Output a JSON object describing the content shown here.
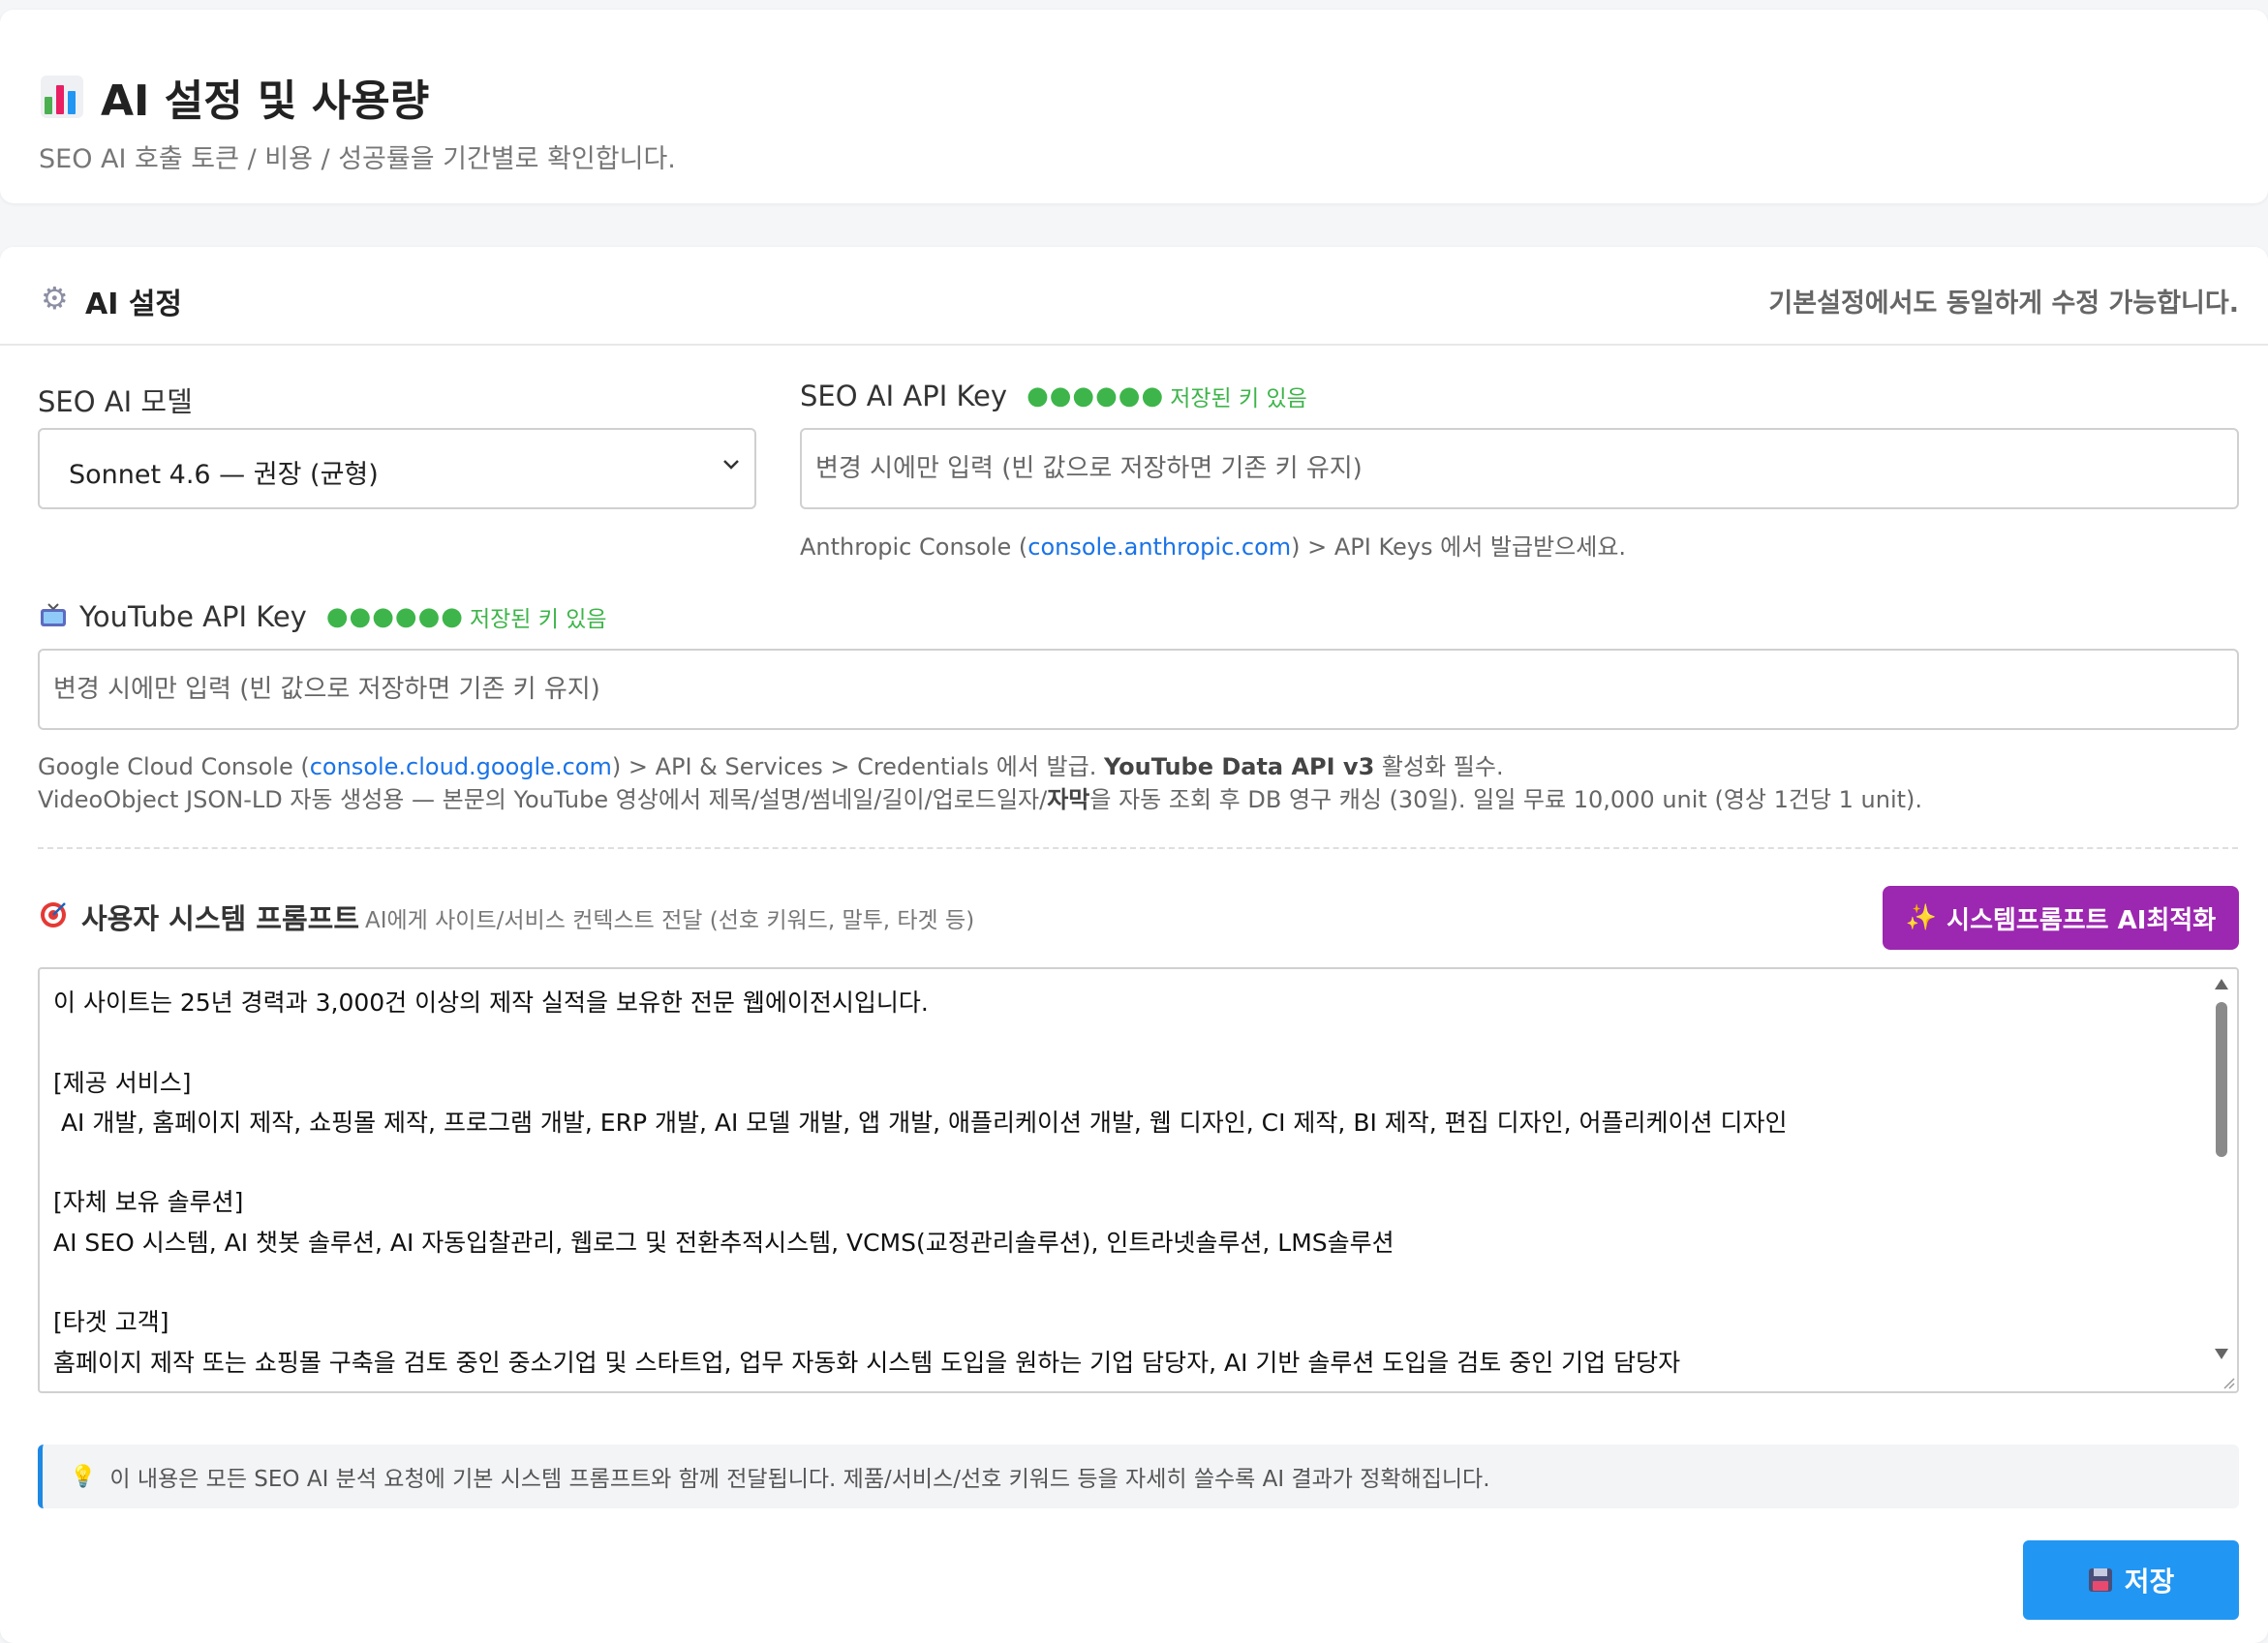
{
  "header": {
    "title": "AI 설정 및 사용량",
    "subtitle": "SEO AI 호출 토큰 / 비용 / 성공률을 기간별로 확인합니다.",
    "icon": "bar-chart-icon"
  },
  "settings_card": {
    "title": "AI 설정",
    "note": "기본설정에서도 동일하게 수정 가능합니다.",
    "icon": "gear-icon"
  },
  "seo_model": {
    "label": "SEO AI 모델",
    "selected": "Sonnet 4.6 — 권장 (균형)"
  },
  "seo_api_key": {
    "label": "SEO AI API Key",
    "masked": "●●●●●●",
    "status": "저장된 키 있음",
    "placeholder": "변경 시에만 입력 (빈 값으로 저장하면 기존 키 유지)",
    "help_prefix": "Anthropic Console (",
    "help_link": "console.anthropic.com",
    "help_suffix": ") > API Keys 에서 발급받으세요."
  },
  "youtube_api_key": {
    "label": "YouTube API Key",
    "masked": "●●●●●●",
    "status": "저장된 키 있음",
    "placeholder": "변경 시에만 입력 (빈 값으로 저장하면 기존 키 유지)",
    "help1_prefix": "Google Cloud Console (",
    "help1_link": "console.cloud.google.com",
    "help1_mid": ") > API & Services > Credentials 에서 발급. ",
    "help1_bold": "YouTube Data API v3",
    "help1_suffix": " 활성화 필수.",
    "help2_prefix": "VideoObject JSON-LD 자동 생성용 — 본문의 YouTube 영상에서 제목/설명/썸네일/길이/업로드일자/",
    "help2_bold": "자막",
    "help2_suffix": "을 자동 조회 후 DB 영구 캐싱 (30일). 일일 무료 10,000 unit (영상 1건당 1 unit)."
  },
  "system_prompt": {
    "label": "사용자 시스템 프롬프트",
    "description": "AI에게 사이트/서비스 컨텍스트 전달 (선호 키워드, 말투, 타겟 등)",
    "optimize_button": "시스템프롬프트 AI최적화",
    "content": "이 사이트는 25년 경력과 3,000건 이상의 제작 실적을 보유한 전문 웹에이전시입니다.\n\n[제공 서비스]\n AI 개발, 홈페이지 제작, 쇼핑몰 제작, 프로그램 개발, ERP 개발, AI 모델 개발, 앱 개발, 애플리케이션 개발, 웹 디자인, CI 제작, BI 제작, 편집 디자인, 어플리케이션 디자인\n\n[자체 보유 솔루션]\nAI SEO 시스템, AI 챗봇 솔루션, AI 자동입찰관리, 웹로그 및 전환추적시스템, VCMS(교정관리솔루션), 인트라넷솔루션, LMS솔루션\n\n[타겟 고객]\n홈페이지 제작 또는 쇼핑몰 구축을 검토 중인 중소기업 및 스타트업, 업무 자동화 시스템 도입을 원하는 기업 담당자, AI 기반 솔루션 도입을 검토 중인 기업 담당자",
    "notice": "이 내용은 모든 SEO AI 분석 요청에 기본 시스템 프롬프트와 함께 전달됩니다. 제품/서비스/선호 키워드 등을 자세히 쓸수록 AI 결과가 정확해집니다."
  },
  "save_button": "저장",
  "colors": {
    "accent_blue": "#2196f3",
    "accent_purple": "#9c27b0",
    "status_green": "#3db54a",
    "link_blue": "#1a73e8"
  }
}
